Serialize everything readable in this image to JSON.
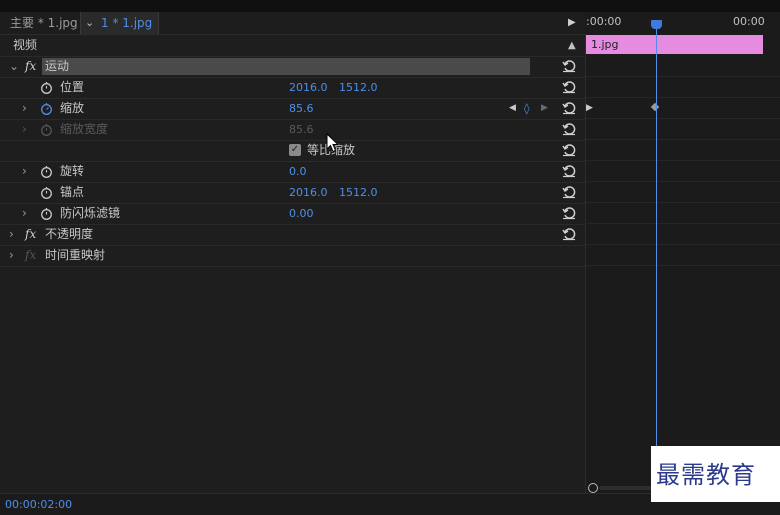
{
  "tabs": {
    "master": "主要 * 1.jpg",
    "clip": "1 * 1.jpg"
  },
  "timeline": {
    "start_tc": ":00:00",
    "end_tc": "00:00",
    "clip_name": "1.jpg"
  },
  "sections": {
    "video": "视频"
  },
  "effects": {
    "motion": {
      "label": "运动",
      "position": {
        "label": "位置",
        "x": "2016.0",
        "y": "1512.0"
      },
      "scale": {
        "label": "缩放",
        "value": "85.6"
      },
      "scale_width": {
        "label": "缩放宽度",
        "value": "85.6"
      },
      "uniform_scale": {
        "label": "等比缩放",
        "checked": true
      },
      "rotation": {
        "label": "旋转",
        "value": "0.0"
      },
      "anchor": {
        "label": "锚点",
        "x": "2016.0",
        "y": "1512.0"
      },
      "anti_flicker": {
        "label": "防闪烁滤镜",
        "value": "0.00"
      }
    },
    "opacity": {
      "label": "不透明度"
    },
    "time_remap": {
      "label": "时间重映射"
    }
  },
  "footer": {
    "timecode": "00:00:02:00"
  },
  "watermark": {
    "text": "最需教育"
  },
  "colors": {
    "accent": "#4f8ee8",
    "clip": "#e58be0"
  }
}
